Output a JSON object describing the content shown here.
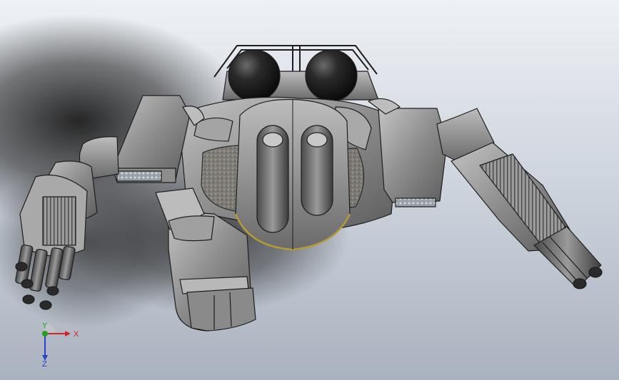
{
  "viewport": {
    "colors": {
      "background_top": "#eef1f5",
      "background_bottom": "#a9b2be",
      "metal": "#8e8e8e",
      "metal_light": "#b5b5b5",
      "metal_dark": "#5e5e5e",
      "edge": "#1e1e1e"
    }
  },
  "triad": {
    "x_label": "X",
    "y_label": "Y",
    "z_label": "Z",
    "x_color": "#d22626",
    "y_color": "#21a121",
    "z_color": "#2a3fcc"
  }
}
